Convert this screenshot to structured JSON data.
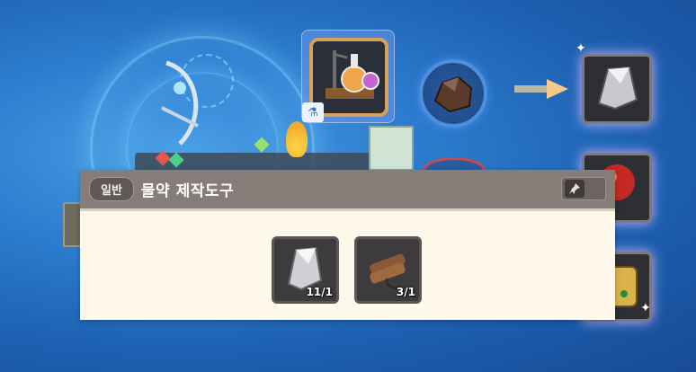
{
  "scene": {
    "background_color": "#2e7fd0",
    "accent_glow": "#dcbfff"
  },
  "crafting_tool": {
    "icon": "potion-crafting-tool-icon",
    "badge_icon": "workbench-icon"
  },
  "input_slot": {
    "icon": "raw-ore-icon"
  },
  "results": [
    {
      "icon": "silver-ingot-icon"
    },
    {
      "icon": "red-gem-icon"
    },
    {
      "icon": "gold-dice-icon"
    }
  ],
  "tooltip": {
    "grade": "일반",
    "title": "물약 제작도구",
    "pin_icon": "pin-icon",
    "header_color": "#867c78",
    "body_color": "#fff9ec",
    "materials": [
      {
        "icon": "silver-ore-ingot-icon",
        "count": "11/1"
      },
      {
        "icon": "wood-bundle-icon",
        "count": "3/1"
      }
    ]
  }
}
